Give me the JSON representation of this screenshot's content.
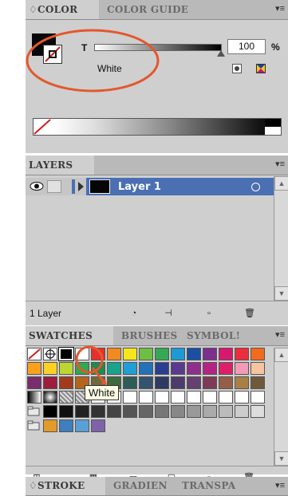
{
  "color_panel": {
    "tabs": [
      {
        "label": "♢COLOR"
      },
      {
        "label": "COLOR GUIDE"
      }
    ],
    "channel_label": "T",
    "tint_value": "100",
    "tint_unit": "%",
    "swatch_name": "White",
    "accent_circle": "#e4572e"
  },
  "layers_panel": {
    "tab": "LAYERS",
    "layer_name": "Layer 1",
    "status": "1 Layer",
    "row_color": "#4a6fb3"
  },
  "swatches_panel": {
    "tabs": [
      {
        "label": "SWATCHES"
      },
      {
        "label": "BRUSHES"
      },
      {
        "label": "SYMBOL!"
      }
    ],
    "tooltip": "White"
  },
  "stroke_panel": {
    "tabs": [
      {
        "label": "♢STROKE"
      },
      {
        "label": "GRADIEN"
      },
      {
        "label": "TRANSPA"
      }
    ]
  }
}
